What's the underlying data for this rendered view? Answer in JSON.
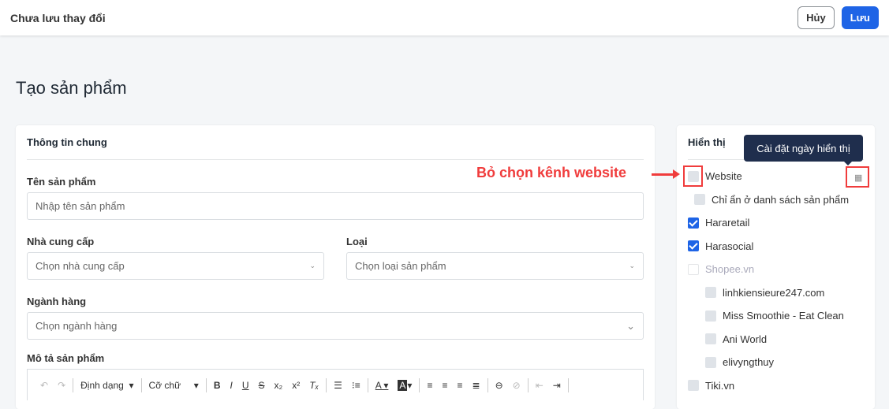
{
  "topbar": {
    "title": "Chưa lưu thay đổi",
    "cancel": "Hủy",
    "save": "Lưu"
  },
  "page_title": "Tạo sản phẩm",
  "general": {
    "header": "Thông tin chung",
    "name_label": "Tên sản phẩm",
    "name_placeholder": "Nhập tên sản phẩm",
    "vendor_label": "Nhà cung cấp",
    "vendor_placeholder": "Chọn nhà cung cấp",
    "type_label": "Loại",
    "type_placeholder": "Chọn loại sản phẩm",
    "category_label": "Ngành hàng",
    "category_placeholder": "Chọn ngành hàng",
    "desc_label": "Mô tả sản phẩm",
    "toolbar": {
      "format": "Định dạng",
      "font_size": "Cỡ chữ"
    }
  },
  "visibility": {
    "header": "Hiển thị",
    "tooltip": "Cài đặt ngày hiển thị",
    "channels": [
      {
        "label": "Website",
        "checked": false
      },
      {
        "label": "Chỉ ẩn ở danh sách sản phẩm",
        "checked": false
      },
      {
        "label": "Hararetail",
        "checked": true
      },
      {
        "label": "Harasocial",
        "checked": true
      },
      {
        "label": "Shopee.vn",
        "checked": false
      },
      {
        "label": "linhkiensieure247.com",
        "checked": false
      },
      {
        "label": "Miss Smoothie - Eat Clean",
        "checked": false
      },
      {
        "label": "Ani World",
        "checked": false
      },
      {
        "label": "elivyngthuy",
        "checked": false
      },
      {
        "label": "Tiki.vn",
        "checked": false
      }
    ]
  },
  "annotation": "Bỏ chọn kênh website"
}
